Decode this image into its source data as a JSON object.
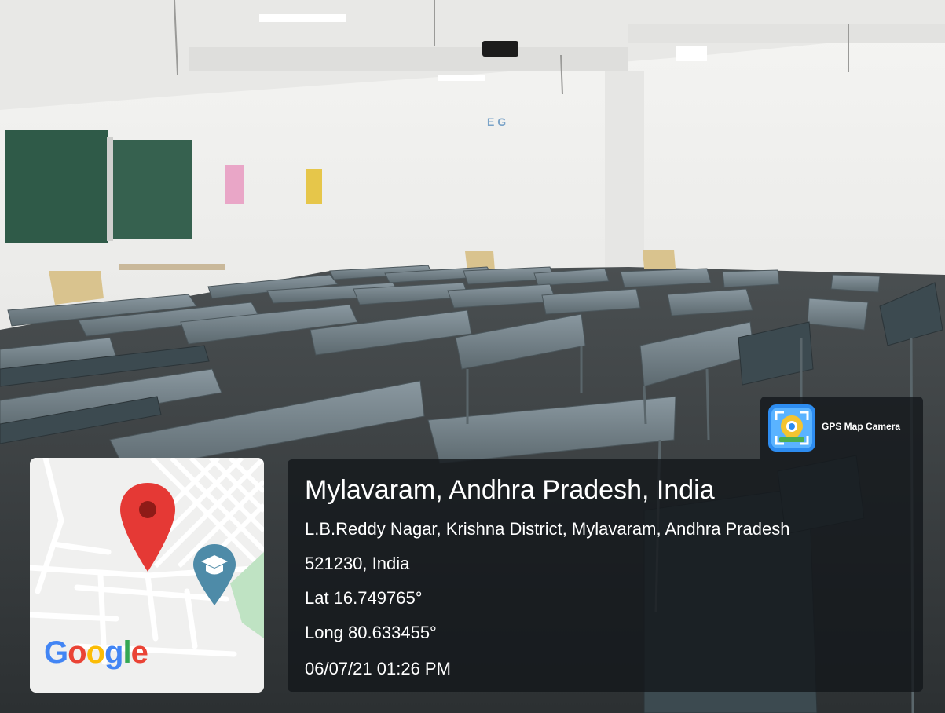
{
  "overlay": {
    "app_name": "GPS Map Camera",
    "location_title": "Mylavaram, Andhra Pradesh, India",
    "address_line_1": "L.B.Reddy Nagar, Krishna District, Mylavaram, Andhra Pradesh",
    "address_line_2": "521230, India",
    "latitude": "Lat 16.749765°",
    "longitude": "Long 80.633455°",
    "datetime": "06/07/21 01:26 PM"
  },
  "map": {
    "logo": {
      "letters": [
        {
          "char": "G",
          "color": "#4285F4"
        },
        {
          "char": "o",
          "color": "#EA4335"
        },
        {
          "char": "o",
          "color": "#FBBC05"
        },
        {
          "char": "g",
          "color": "#4285F4"
        },
        {
          "char": "l",
          "color": "#34A853"
        },
        {
          "char": "e",
          "color": "#EA4335"
        }
      ]
    },
    "pin_icon": "location-pin-icon",
    "pin_color": "#E53935",
    "poi_icon": "graduation-cap-icon",
    "poi_color": "#4E8BA8"
  },
  "scene": {
    "wall_color": "#EEEEEC",
    "board_color": "#2F5A48",
    "floor_color": "#3F4446",
    "desk_color": "#7D8C94",
    "chair_color": "#D9C38E"
  },
  "wall_sign": "E G"
}
